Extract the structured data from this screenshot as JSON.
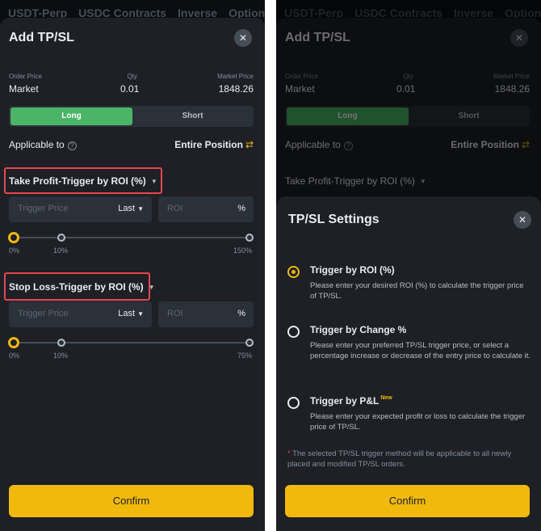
{
  "nav_tabs": [
    "USDT-Perp",
    "USDC Contracts",
    "Inverse",
    "Option"
  ],
  "sheet": {
    "title": "Add TP/SL",
    "close": "✕"
  },
  "order": {
    "price_label": "Order Price",
    "price_value": "Market",
    "qty_label": "Qty",
    "qty_value": "0.01",
    "market_label": "Market Price",
    "market_value": "1848.26"
  },
  "side": {
    "long": "Long",
    "short": "Short",
    "selected": "Long"
  },
  "applicable": {
    "label": "Applicable to",
    "value": "Entire Position"
  },
  "take_profit": {
    "label": "Take Profit-Trigger by ROI (%)",
    "trigger_placeholder": "Trigger Price",
    "price_type": "Last",
    "roi_placeholder": "ROI",
    "unit": "%",
    "slider": {
      "value_percent": 0,
      "labels": [
        "0%",
        "10%",
        "150%"
      ]
    }
  },
  "stop_loss": {
    "label": "Stop Loss-Trigger by ROI (%)",
    "trigger_placeholder": "Trigger Price",
    "price_type": "Last",
    "roi_placeholder": "ROI",
    "unit": "%",
    "slider": {
      "value_percent": 0,
      "labels": [
        "0%",
        "10%",
        "75%"
      ]
    }
  },
  "confirm_label": "Confirm",
  "settings": {
    "title": "TP/SL Settings",
    "options": [
      {
        "title": "Trigger by ROI (%)",
        "desc": "Please enter your desired ROI (%) to calculate the trigger price of TP/SL.",
        "selected": true,
        "badge": ""
      },
      {
        "title": "Trigger by Change %",
        "desc": "Please enter your preferred TP/SL trigger price, or select a percentage increase or decrease of the entry price to calculate it.",
        "selected": false,
        "badge": ""
      },
      {
        "title": "Trigger by P&L",
        "desc": "Please enter your expected profit or loss to calculate the trigger price of TP/SL.",
        "selected": false,
        "badge": "New"
      }
    ],
    "note_star": "*",
    "note": " The selected TP/SL trigger method will be applicable to all newly placed and modified TP/SL orders.",
    "confirm_label": "Confirm"
  },
  "colors": {
    "accent": "#f0b90b",
    "long_green": "#4bb567",
    "highlight_red": "#e5474c",
    "sheet_bg": "#1e2026"
  },
  "icons": [
    "close-icon",
    "info-icon",
    "swap-icon",
    "caret-down-icon",
    "radio-icon"
  ]
}
